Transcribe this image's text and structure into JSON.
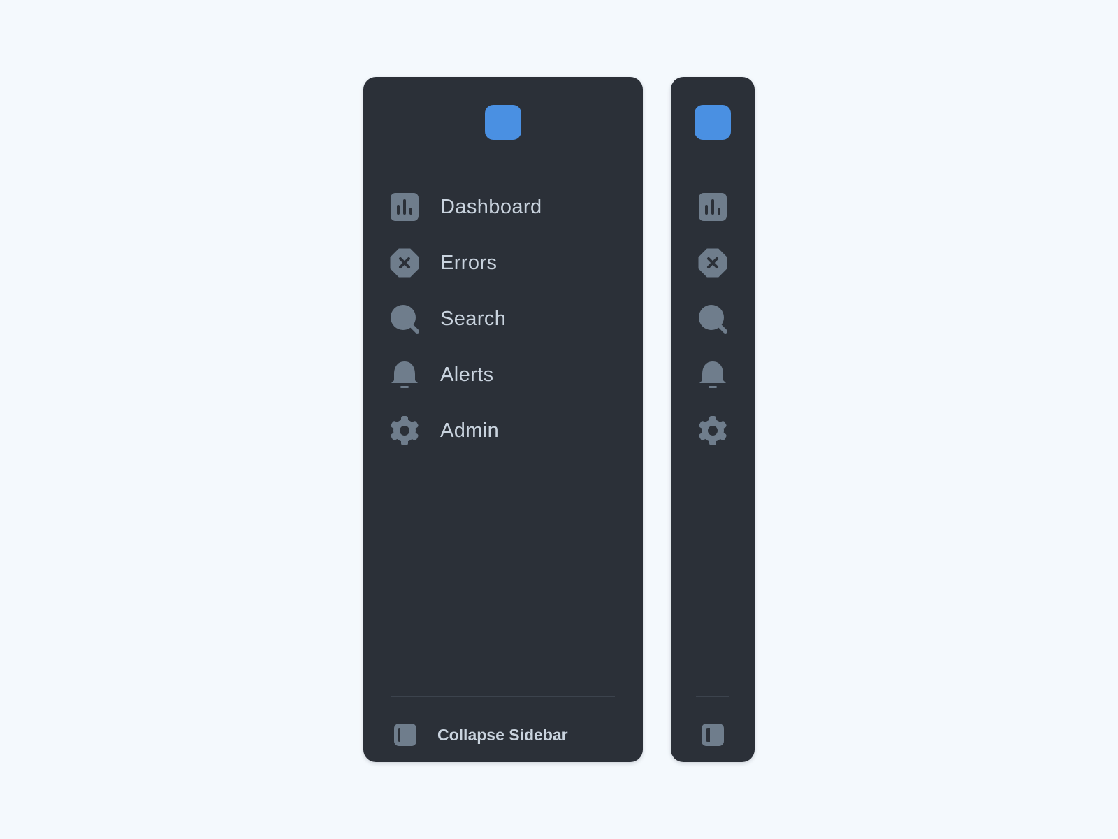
{
  "colors": {
    "background": "#f4f9fd",
    "sidebar_bg": "#2b3038",
    "logo": "#4a90e2",
    "icon": "#6f7d8c",
    "label": "#c9d3de",
    "divider": "#3c434d"
  },
  "expanded_sidebar": {
    "logo_icon": "app-logo",
    "nav_items": [
      {
        "label": "Dashboard",
        "icon": "bar-chart-icon"
      },
      {
        "label": "Errors",
        "icon": "error-octagon-icon"
      },
      {
        "label": "Search",
        "icon": "search-icon"
      },
      {
        "label": "Alerts",
        "icon": "bell-icon"
      },
      {
        "label": "Admin",
        "icon": "gear-icon"
      }
    ],
    "collapse_label": "Collapse Sidebar",
    "collapse_icon": "sidebar-toggle-icon"
  },
  "collapsed_sidebar": {
    "logo_icon": "app-logo",
    "nav_icons": [
      "bar-chart-icon",
      "error-octagon-icon",
      "search-icon",
      "bell-icon",
      "gear-icon"
    ],
    "expand_icon": "sidebar-toggle-icon"
  }
}
